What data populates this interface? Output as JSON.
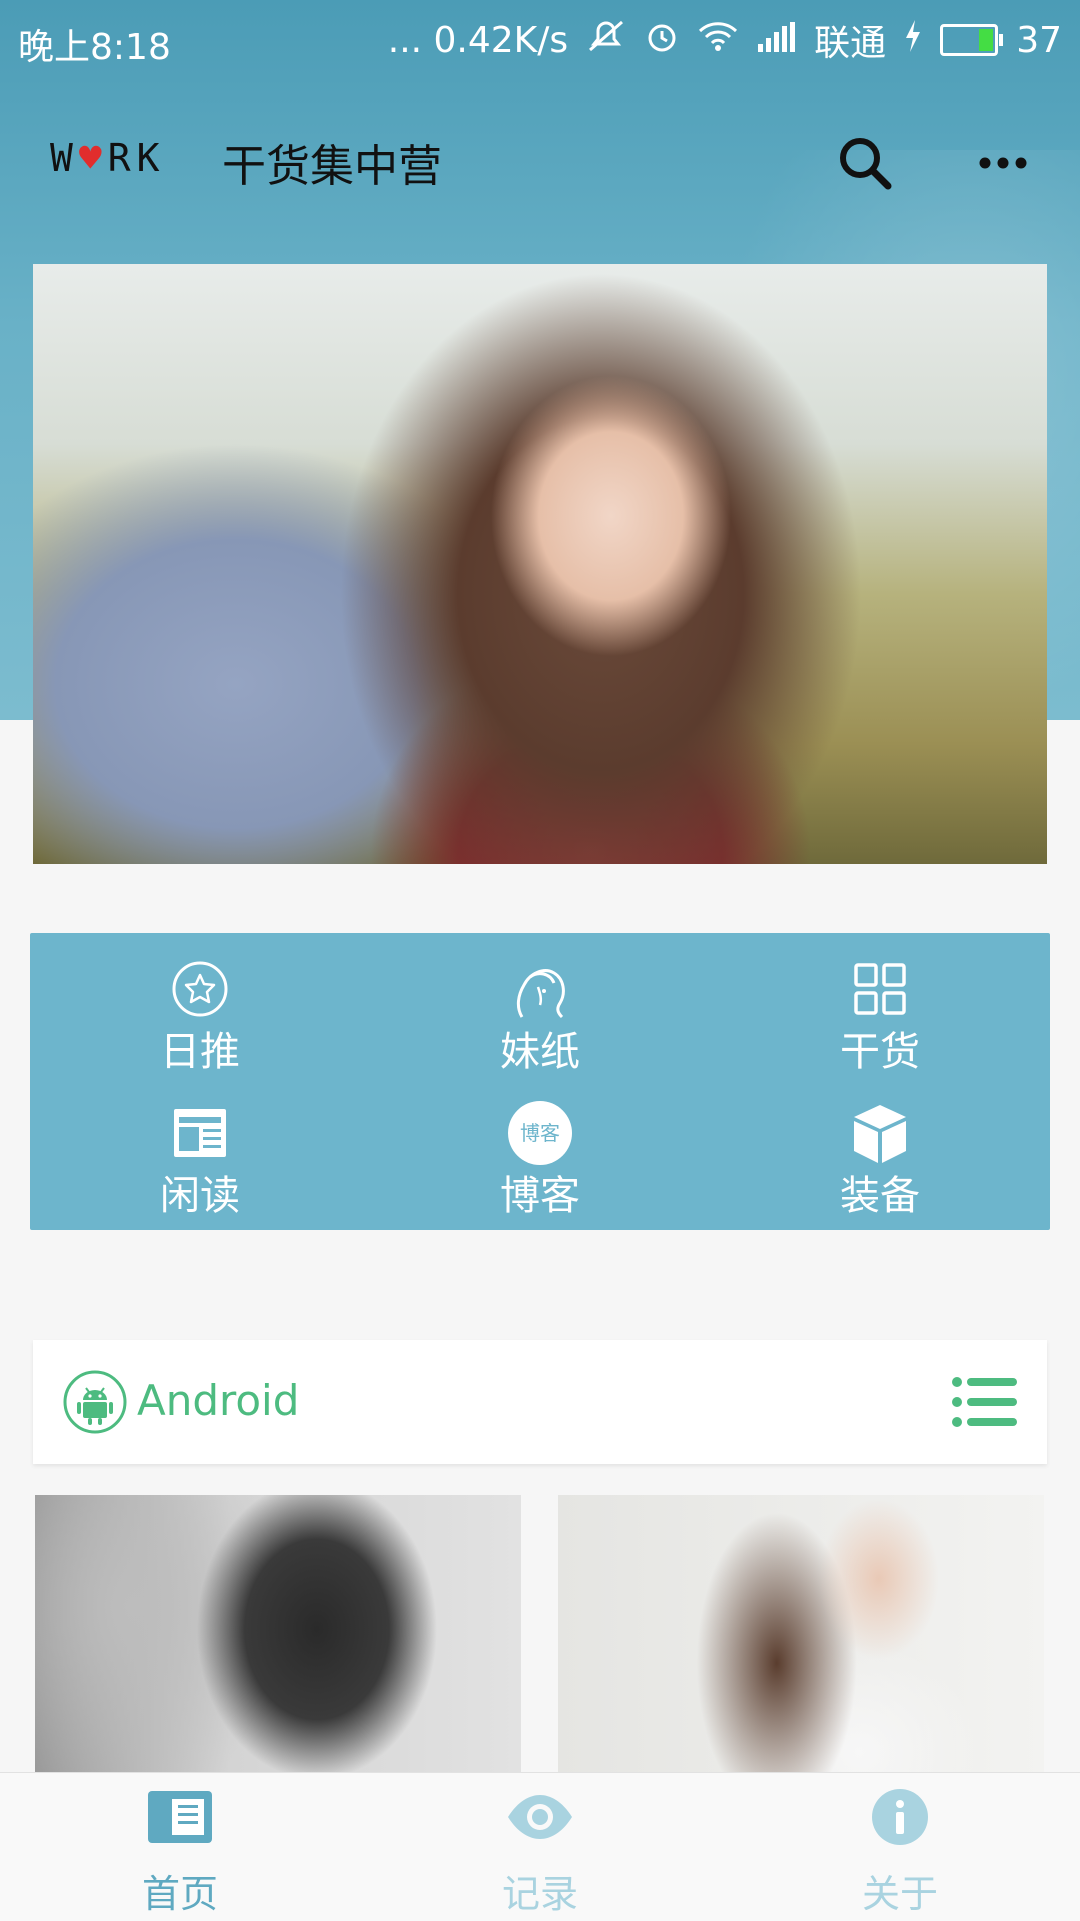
{
  "status_bar": {
    "time": "晚上8:18",
    "network_speed": "... 0.42K/s",
    "carrier": "联通",
    "battery": "37"
  },
  "app_bar": {
    "logo_text": "W♥RK",
    "title": "干货集中营"
  },
  "categories": [
    {
      "label": "日推",
      "icon": "star-circle-icon"
    },
    {
      "label": "妹纸",
      "icon": "girl-icon"
    },
    {
      "label": "干货",
      "icon": "grid-icon"
    },
    {
      "label": "闲读",
      "icon": "newspaper-icon"
    },
    {
      "label": "博客",
      "icon": "blog-badge-icon",
      "badge": "博客"
    },
    {
      "label": "装备",
      "icon": "cube-icon"
    }
  ],
  "section": {
    "title": "Android"
  },
  "bottom_nav": [
    {
      "label": "首页",
      "active": true
    },
    {
      "label": "记录",
      "active": false
    },
    {
      "label": "关于",
      "active": false
    }
  ],
  "colors": {
    "header": "#5fa9c1",
    "grid_card": "#6db5cc",
    "section_accent": "#4dbb80",
    "nav_active": "#5fa9c1",
    "nav_inactive": "#a9d3e0"
  }
}
